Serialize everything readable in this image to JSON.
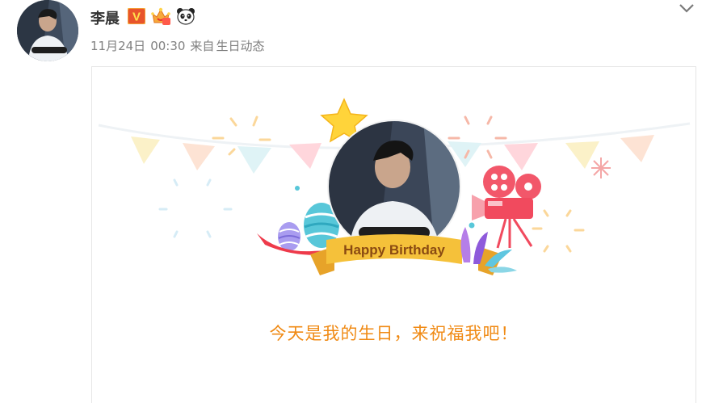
{
  "author": {
    "name": "李晨",
    "verified_badge": "V",
    "badges": [
      "vip-crown-icon",
      "panda-icon"
    ]
  },
  "meta": {
    "date": "11月24日",
    "time": "00:30",
    "from_label": "来自",
    "source": "生日动态"
  },
  "card": {
    "banner_text": "Happy Birthday",
    "message": "今天是我的生日，来祝福我吧！"
  },
  "colors": {
    "verified": "#e8542c",
    "message": "#f08a14",
    "ribbon": "#f5c13a",
    "ribbon_text": "#8a4a12"
  }
}
